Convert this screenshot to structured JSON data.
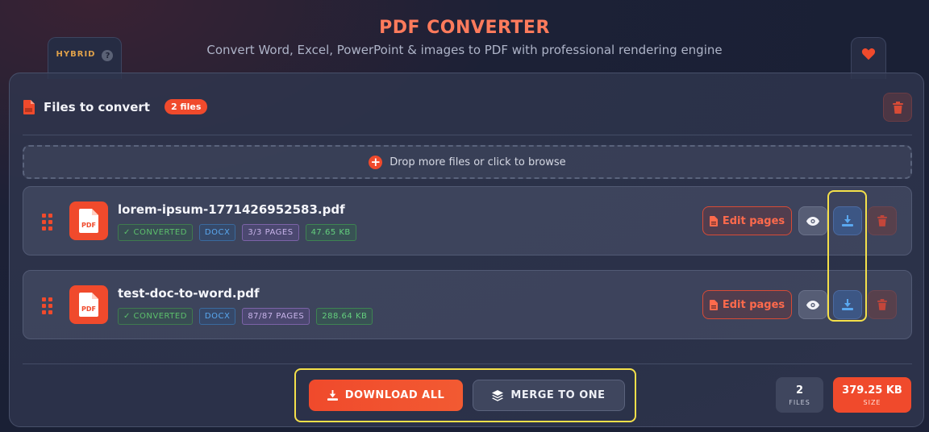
{
  "header": {
    "title": "PDF CONVERTER",
    "subtitle": "Convert Word, Excel, PowerPoint & images to PDF with professional rendering engine"
  },
  "mode_tab": {
    "label": "HYBRID",
    "help": "?"
  },
  "panel": {
    "title": "Files to convert",
    "count_badge": "2 files",
    "dropzone_text": "Drop more files or click to browse"
  },
  "files": [
    {
      "name": "lorem-ipsum-1771426952583.pdf",
      "status": "✓ CONVERTED",
      "format": "DOCX",
      "pages": "3/3 PAGES",
      "size": "47.65 KB",
      "edit_label": "Edit pages"
    },
    {
      "name": "test-doc-to-word.pdf",
      "status": "✓ CONVERTED",
      "format": "DOCX",
      "pages": "87/87 PAGES",
      "size": "288.64 KB",
      "edit_label": "Edit pages"
    }
  ],
  "actions": {
    "download_all": "DOWNLOAD ALL",
    "merge": "MERGE TO ONE"
  },
  "stats": {
    "files_value": "2",
    "files_label": "FILES",
    "size_value": "379.25 KB",
    "size_label": "SIZE"
  },
  "icons": {
    "pdf_icon_text": "PDF",
    "colors": {
      "accent": "#f04a2c",
      "highlight": "#f4e04a",
      "title": "#ff7b5c"
    }
  }
}
